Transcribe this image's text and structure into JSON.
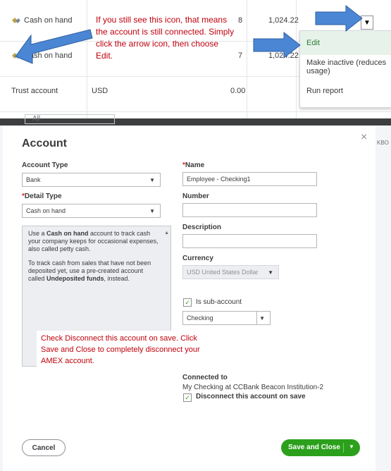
{
  "table": {
    "rows": [
      {
        "name": "Cash on hand",
        "type": "",
        "count": "8",
        "balance": "1,024.22"
      },
      {
        "name": "Cash on hand",
        "type": "",
        "count": "7",
        "balance": "1,024.22"
      },
      {
        "name": "Trust account",
        "type": "USD",
        "count": "",
        "balance": "0.00"
      }
    ],
    "filter_value": "All",
    "side_header": "KBO"
  },
  "row_menu": {
    "items": [
      "Edit",
      "Make inactive (reduces usage)",
      "Run report"
    ]
  },
  "callout_top": "If you still see this icon, that means the account is still connected. Simply click the arrow icon, then choose Edit.",
  "callout_bottom": "Check Disconnect this account on save. Click Save and Close to completely disconnect your AMEX account.",
  "modal": {
    "title": "Account",
    "account_type": {
      "label": "Account Type",
      "value": "Bank"
    },
    "detail_type": {
      "label": "Detail Type",
      "value": "Cash on hand"
    },
    "name": {
      "label": "Name",
      "value": "Employee - Checking1"
    },
    "number": {
      "label": "Number",
      "value": ""
    },
    "description": {
      "label": "Description",
      "value": ""
    },
    "currency": {
      "label": "Currency",
      "value": "USD United States Dollar"
    },
    "help": {
      "p1_pre": "Use a ",
      "p1_bold": "Cash on hand",
      "p1_post": " account to track cash your company keeps for occasional expenses, also called petty cash.",
      "p2_pre": "To track cash from sales that have not been deposited yet, use a pre-created account called ",
      "p2_bold": "Undeposited funds",
      "p2_post": ", instead."
    },
    "sub_account": {
      "label": "Is sub-account",
      "checked": true,
      "parent": "Checking"
    },
    "connected_to": {
      "label": "Connected to",
      "value": "My Checking at CCBank Beacon Institution-2"
    },
    "disconnect": {
      "label": "Disconnect this account on save",
      "checked": true
    },
    "cancel_label": "Cancel",
    "save_label": "Save and Close"
  },
  "colors": {
    "primary_green": "#2ca01c",
    "callout_red": "#c0000b",
    "arrow_blue": "#4a86d4"
  }
}
